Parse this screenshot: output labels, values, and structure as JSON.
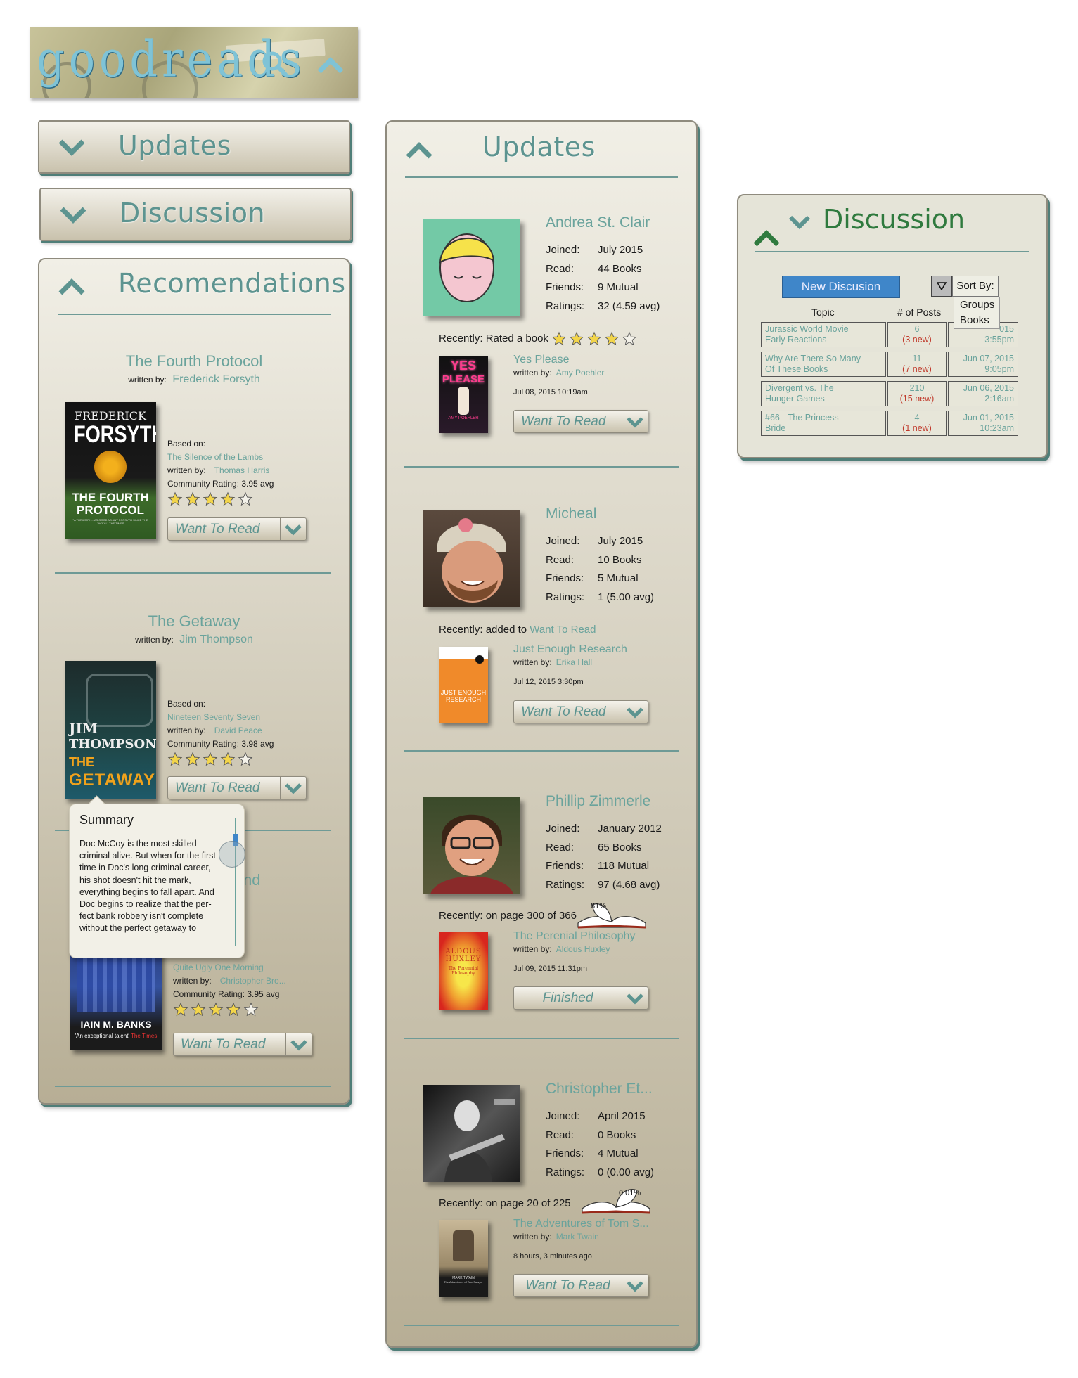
{
  "logo": {
    "text": "goodreads"
  },
  "left": {
    "updates_label": "Updates",
    "discussion_label": "Discussion",
    "recs": {
      "title": "Recomendations",
      "items": [
        {
          "title": "The Fourth Protocol",
          "written_by": "written by:",
          "author": "Frederick Forsyth",
          "based_on": "Based on:",
          "based_title": "The Silence of the Lambs",
          "based_author": "Thomas Harris",
          "rating": "Community Rating: 3.95 avg",
          "button": "Want To Read",
          "stars": 4,
          "cover": {
            "line1": "FREDERICK",
            "line2": "FORSYTH",
            "line3": "THE FOURTH",
            "line4": "PROTOCOL",
            "tag": "\"A THRIUMPH... AS GOOD AS ANY FORSYTH SINCE THE JACKAL\" THE TIMES"
          }
        },
        {
          "title": "The Getaway",
          "written_by": "written by:",
          "author": "Jim Thompson",
          "based_on": "Based on:",
          "based_title": "Nineteen Seventy Seven",
          "based_author": "David Peace",
          "rating": "Community Rating: 3.98 avg",
          "button": "Want To Read",
          "stars": 4,
          "cover": {
            "line1": "JIM",
            "line2": "THOMPSON",
            "line3": "THE",
            "line4": "GETAWAY"
          }
        },
        {
          "title_partial": "nd",
          "based_title": "Quite Ugly One Morning",
          "written_by": "written by:",
          "based_author": "Christopher Bro...",
          "rating": "Community Rating: 3.95 avg",
          "button": "Want To Read",
          "stars": 4,
          "cover": {
            "line1": "IAIN M. BANKS",
            "line2": "'An exceptional talent'",
            "line3": "The Times"
          }
        }
      ],
      "summary": {
        "heading": "Summary",
        "lines": [
          "Doc McCoy is the most skilled",
          "criminal alive. But when for the first",
          "time in Doc's long criminal career,",
          "his shot doesn't hit the mark,",
          "everything begins to fall apart. And",
          "Doc begins to realize that the per-",
          "fect bank robbery isn't complete",
          "without the perfect getaway to"
        ]
      }
    }
  },
  "middle": {
    "title": "Updates",
    "labels": {
      "joined": "Joined:",
      "read": "Read:",
      "friends": "Friends:",
      "ratings": "Ratings:"
    },
    "users": [
      {
        "name": "Andrea St. Clair",
        "joined": "July 2015",
        "read": "44 Books",
        "friends": "9 Mutual",
        "ratings": "32 (4.59 avg)",
        "recent": "Recently: Rated a book",
        "book": "Yes Please",
        "written_by": "written by:",
        "author": "Amy Poehler",
        "time": "Jul 08, 2015 10:19am",
        "button": "Want To Read",
        "cover": {
          "line1": "YES",
          "line2": "PLEASE",
          "line3": "AMY POEHLER"
        },
        "stars": 4
      },
      {
        "name": "Micheal",
        "joined": "July 2015",
        "read": "10 Books",
        "friends": "5 Mutual",
        "ratings": "1 (5.00 avg)",
        "recent": "Recently: added to",
        "recent_link": "Want To Read",
        "book": "Just Enough Research",
        "written_by": "written by:",
        "author": "Erika Hall",
        "time": "Jul 12, 2015 3:30pm",
        "button": "Want To Read",
        "cover": {
          "line1": "JUST ENOUGH",
          "line2": "RESEARCH"
        }
      },
      {
        "name": "Phillip Zimmerle",
        "joined": "January 2012",
        "read": "65 Books",
        "friends": "118 Mutual",
        "ratings": "97 (4.68 avg)",
        "recent": "Recently: on page 300 of 366",
        "progress_label": "81%",
        "progress": 0.81,
        "book": "The Perenial Philosophy",
        "written_by": "written by:",
        "author": "Aldous Huxley",
        "time": "Jul 09, 2015 11:31pm",
        "button": "Finished",
        "cover": {
          "line1": "ALDOUS",
          "line2": "HUXLEY",
          "line3": "The Perennial Philosophy"
        }
      },
      {
        "name": "Christopher Et...",
        "joined": "April 2015",
        "read": "0 Books",
        "friends": "4 Mutual",
        "ratings": "0 (0.00 avg)",
        "recent": "Recently: on page 20 of 225",
        "progress_label": "0.01%",
        "progress": 0.0001,
        "book": "The Adventures of Tom S...",
        "written_by": "written by:",
        "author": "Mark Twain",
        "time": "8 hours, 3 minutes ago",
        "button": "Want To Read",
        "cover": {
          "line1": "MARK TWAIN",
          "line2": "The Adventures of Tom Sawyer"
        }
      }
    ]
  },
  "right": {
    "title": "Discussion",
    "new_button": "New Discusion",
    "sort_label": "Sort By:",
    "sort_options": [
      "Groups",
      "Books"
    ],
    "col_topic": "Topic",
    "col_posts": "# of Posts",
    "rows": [
      {
        "topic1": "Jurassic World Movie",
        "topic2": "Early Reactions",
        "posts": "6",
        "new": "(3 new)",
        "date": "015",
        "time": "3:55pm"
      },
      {
        "topic1": "Why Are There So Many",
        "topic2": "Of These Books",
        "posts": "11",
        "new": "(7 new)",
        "date": "Jun 07, 2015",
        "time": "9:05pm"
      },
      {
        "topic1": "Divergent vs. The",
        "topic2": "Hunger Games",
        "posts": "210",
        "new": "(15 new)",
        "date": "Jun 06, 2015",
        "time": "2:16am"
      },
      {
        "topic1": "#66 - The Princess",
        "topic2": "Bride",
        "posts": "4",
        "new": "(1 new)",
        "date": "Jun 01, 2015",
        "time": "10:23am"
      }
    ]
  },
  "colors": {
    "teal": "#6aa39c",
    "heading": "#5d9490",
    "accent_blue": "#3f86c9",
    "red": "#c0392b",
    "panel_shadow": "#4f7e78"
  }
}
